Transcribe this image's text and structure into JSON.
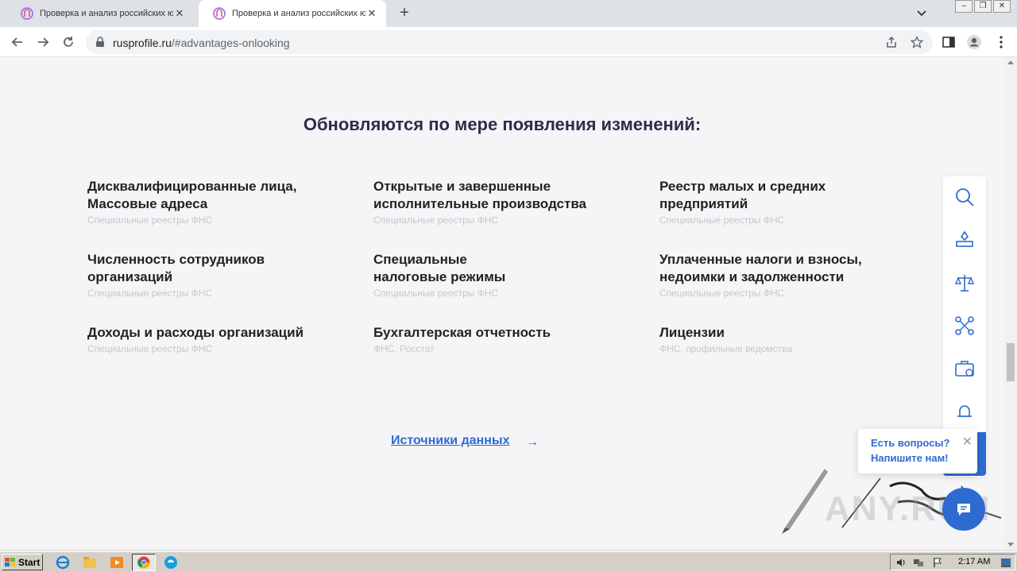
{
  "browser": {
    "tabs": [
      {
        "title": "Проверка и анализ российских юр",
        "active": false
      },
      {
        "title": "Проверка и анализ российских юр",
        "active": true
      }
    ],
    "url_host": "rusprofile.ru",
    "url_path": "/#advantages-onlooking"
  },
  "page": {
    "heading": "Обновляются по мере появления изменений:",
    "items": [
      {
        "title": "Дисквалифицированные лица,\nМассовые адреса",
        "source": "Специальные реестры ФНС"
      },
      {
        "title": "Открытые и завершенные\nисполнительные производства",
        "source": "Специальные реестры ФНС"
      },
      {
        "title": "Реестр малых и средних\nпредприятий",
        "source": "Специальные реестры ФНС"
      },
      {
        "title": "Численность сотрудников\nорганизаций",
        "source": "Специальные реестры ФНС"
      },
      {
        "title": "Специальные\nналоговые режимы",
        "source": "Специальные реестры ФНС"
      },
      {
        "title": "Уплаченные налоги и взносы,\nнедоимки и задолженности",
        "source": "Специальные реестры ФНС"
      },
      {
        "title": "Доходы и расходы организаций",
        "source": "Специальные реестры ФНС"
      },
      {
        "title": "Бухгалтерская отчетность",
        "source": "ФНС, Росстат"
      },
      {
        "title": "Лицензии",
        "source": "ФНС, профильные ведомства"
      }
    ],
    "sources_link": "Источники данных",
    "sources_arrow": "→",
    "chat_bubble": {
      "line1": "Есть вопросы?",
      "line2": "Напишите нам!",
      "close": "✕"
    },
    "watermark": "ANY.RUN"
  },
  "taskbar": {
    "start_label": "Start",
    "clock": "2:17 AM"
  },
  "colors": {
    "accent": "#2d6bd1",
    "heading": "#2a2e4d",
    "source": "#c5c7cc"
  }
}
